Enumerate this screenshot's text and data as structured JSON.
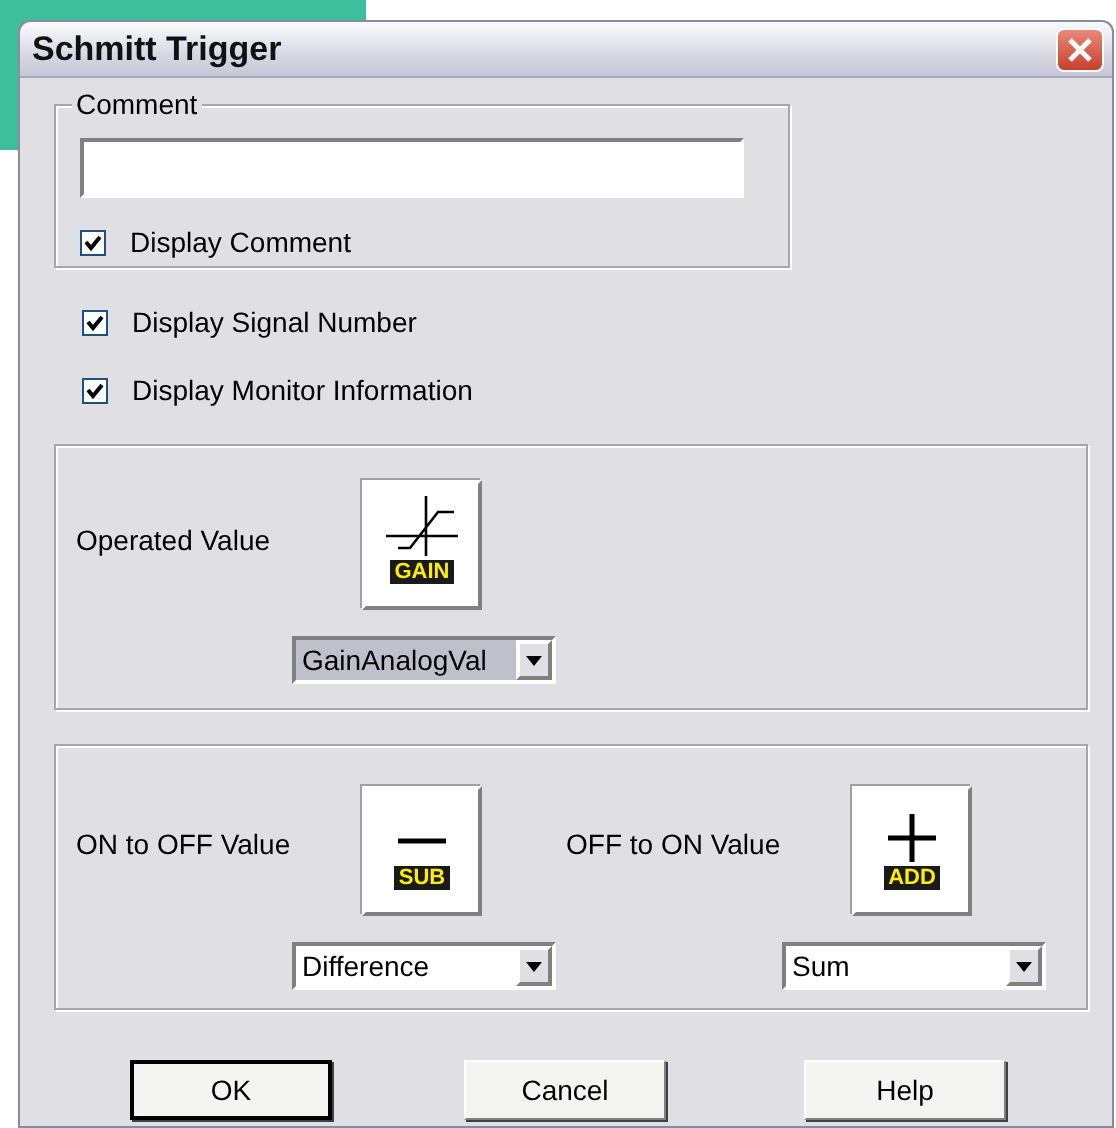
{
  "window": {
    "title": "Schmitt Trigger"
  },
  "comment_group": {
    "title": "Comment",
    "display_comment": {
      "label": "Display Comment",
      "checked": true
    }
  },
  "options": [
    {
      "label": "Display Signal Number",
      "checked": true
    },
    {
      "label": "Display Monitor Information",
      "checked": true
    }
  ],
  "operated_value": {
    "label": "Operated Value",
    "block": {
      "kind": "gain",
      "caption": "GAIN"
    },
    "dropdown": {
      "value": "GainAnalogVal",
      "focused": true
    }
  },
  "thresholds": [
    {
      "label": "ON to OFF Value",
      "block": {
        "kind": "sub",
        "caption": "SUB"
      },
      "dropdown": {
        "value": "Difference",
        "focused": false
      }
    },
    {
      "label": "OFF to ON Value",
      "block": {
        "kind": "add",
        "caption": "ADD"
      },
      "dropdown": {
        "value": "Sum",
        "focused": false
      }
    }
  ],
  "buttons": [
    {
      "label": "OK",
      "default": true
    },
    {
      "label": "Cancel",
      "default": false
    },
    {
      "label": "Help",
      "default": false
    }
  ]
}
